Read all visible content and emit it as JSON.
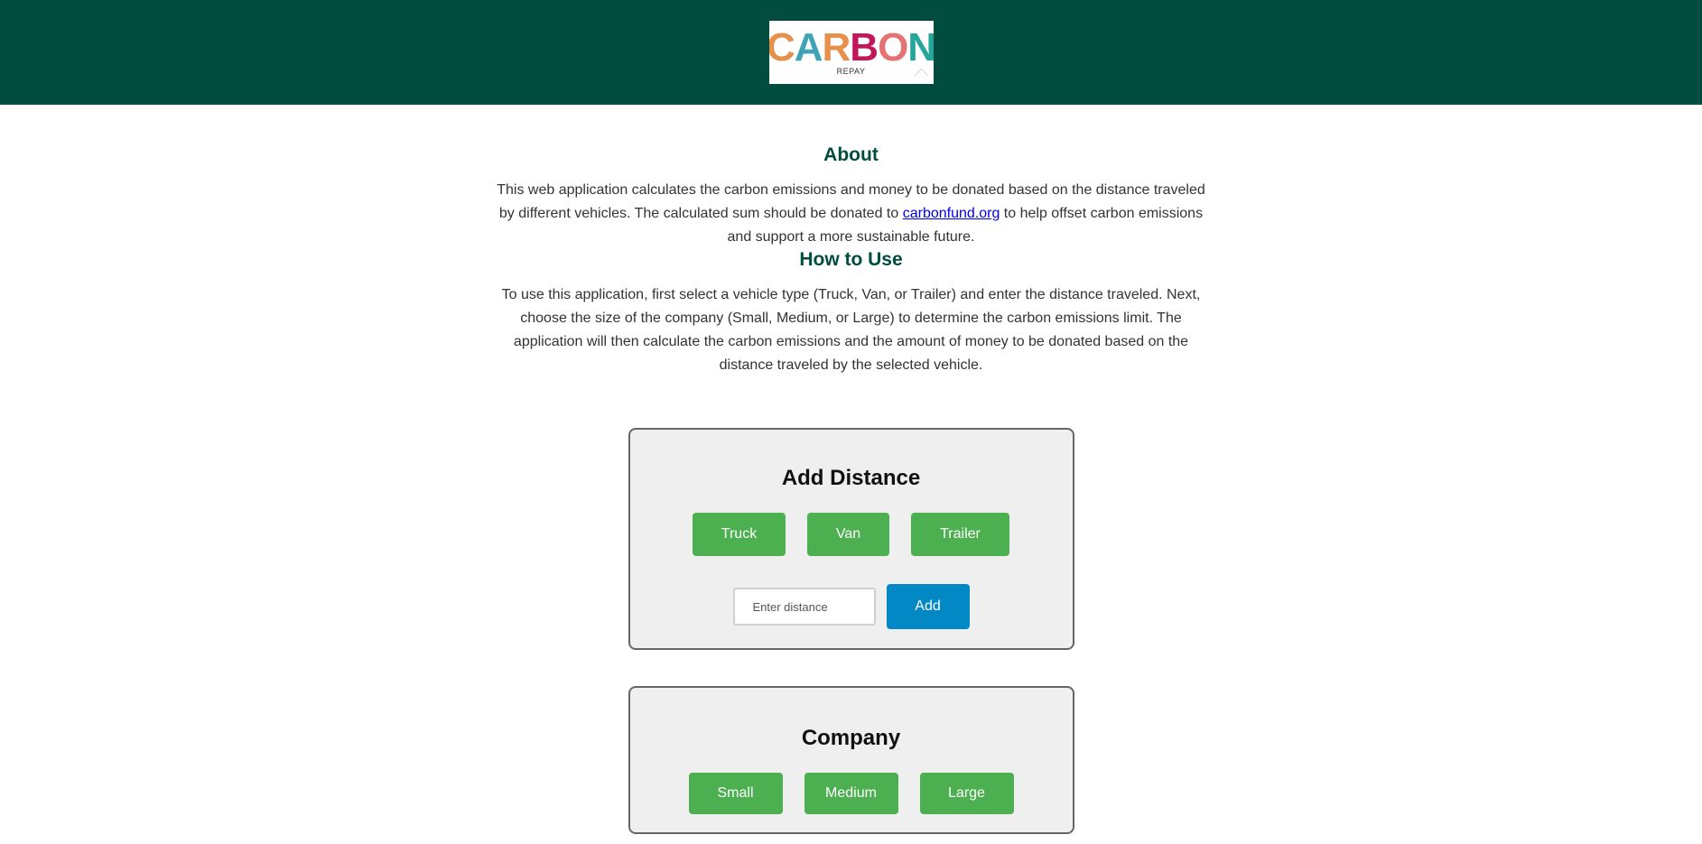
{
  "header": {
    "logo": {
      "letters": [
        {
          "char": "C",
          "color": "#e6914b"
        },
        {
          "char": "A",
          "color": "#3fa3b5"
        },
        {
          "char": "R",
          "color": "#e6914b"
        },
        {
          "char": "B",
          "color": "#c2185b"
        },
        {
          "char": "O",
          "color": "#e57373"
        },
        {
          "char": "N",
          "color": "#26a69a"
        }
      ],
      "subtext": "REPAY"
    },
    "background_color": "#004d40"
  },
  "about": {
    "title": "About",
    "text_before_link": "This web application calculates the carbon emissions and money to be donated based on the distance traveled by different vehicles. The calculated sum should be donated to ",
    "link_text": "carbonfund.org",
    "text_after_link": " to help offset carbon emissions and support a more sustainable future."
  },
  "how_to_use": {
    "title": "How to Use",
    "text": "To use this application, first select a vehicle type (Truck, Van, or Trailer) and enter the distance traveled. Next, choose the size of the company (Small, Medium, or Large) to determine the carbon emissions limit. The application will then calculate the carbon emissions and the amount of money to be donated based on the distance traveled by the selected vehicle."
  },
  "add_distance": {
    "title": "Add Distance",
    "vehicles": [
      "Truck",
      "Van",
      "Trailer"
    ],
    "input_placeholder": "Enter distance",
    "input_value": "",
    "add_label": "Add"
  },
  "company": {
    "title": "Company",
    "sizes": [
      "Small",
      "Medium",
      "Large"
    ]
  },
  "colors": {
    "accent_green": "#4caf50",
    "add_blue": "#0288c4",
    "heading_green": "#004d40"
  }
}
